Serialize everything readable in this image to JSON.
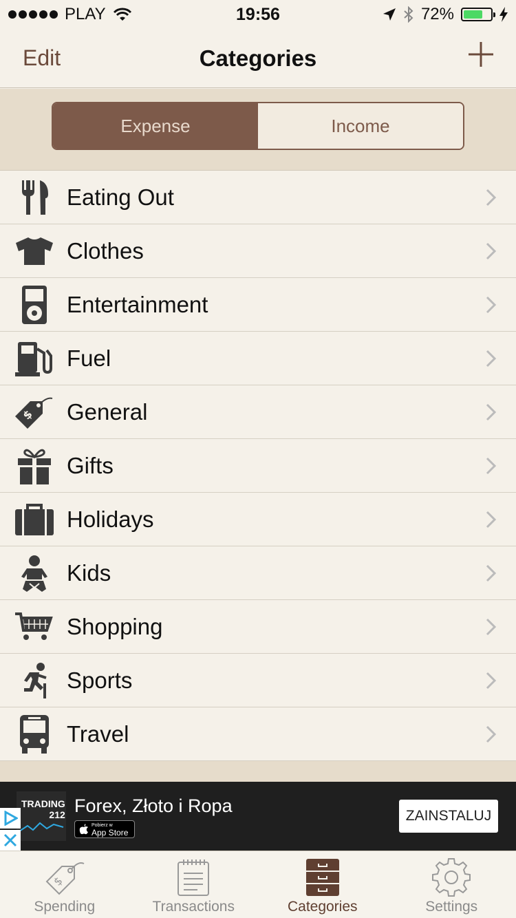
{
  "status_bar": {
    "carrier": "PLAY",
    "time": "19:56",
    "battery_percent": "72%",
    "battery_level": 0.72
  },
  "nav": {
    "edit_label": "Edit",
    "title": "Categories",
    "add_icon": "plus-icon"
  },
  "segment": {
    "options": [
      "Expense",
      "Income"
    ],
    "selected": "Expense"
  },
  "categories": [
    {
      "label": "Eating Out",
      "icon": "fork-knife-icon"
    },
    {
      "label": "Clothes",
      "icon": "tshirt-icon"
    },
    {
      "label": "Entertainment",
      "icon": "ipod-icon"
    },
    {
      "label": "Fuel",
      "icon": "fuel-pump-icon"
    },
    {
      "label": "General",
      "icon": "price-tag-icon"
    },
    {
      "label": "Gifts",
      "icon": "gift-icon"
    },
    {
      "label": "Holidays",
      "icon": "suitcase-icon"
    },
    {
      "label": "Kids",
      "icon": "baby-icon"
    },
    {
      "label": "Shopping",
      "icon": "shopping-cart-icon"
    },
    {
      "label": "Sports",
      "icon": "runner-icon"
    },
    {
      "label": "Travel",
      "icon": "bus-icon"
    }
  ],
  "ad": {
    "brand_line1": "TRADING",
    "brand_line2": "212",
    "title": "Forex, Złoto i Ropa",
    "store_small": "Pobierz w",
    "store_label": "App Store",
    "install_label": "ZAINSTALUJ"
  },
  "tabs": [
    {
      "label": "Spending",
      "icon": "price-tag-icon",
      "active": false
    },
    {
      "label": "Transactions",
      "icon": "notepad-icon",
      "active": false
    },
    {
      "label": "Categories",
      "icon": "drawers-icon",
      "active": true
    },
    {
      "label": "Settings",
      "icon": "gear-icon",
      "active": false
    }
  ],
  "colors": {
    "accent": "#7d5a4a",
    "background": "#f5f1e9",
    "texture": "#e6dccb",
    "icon": "#3c3c3c"
  }
}
